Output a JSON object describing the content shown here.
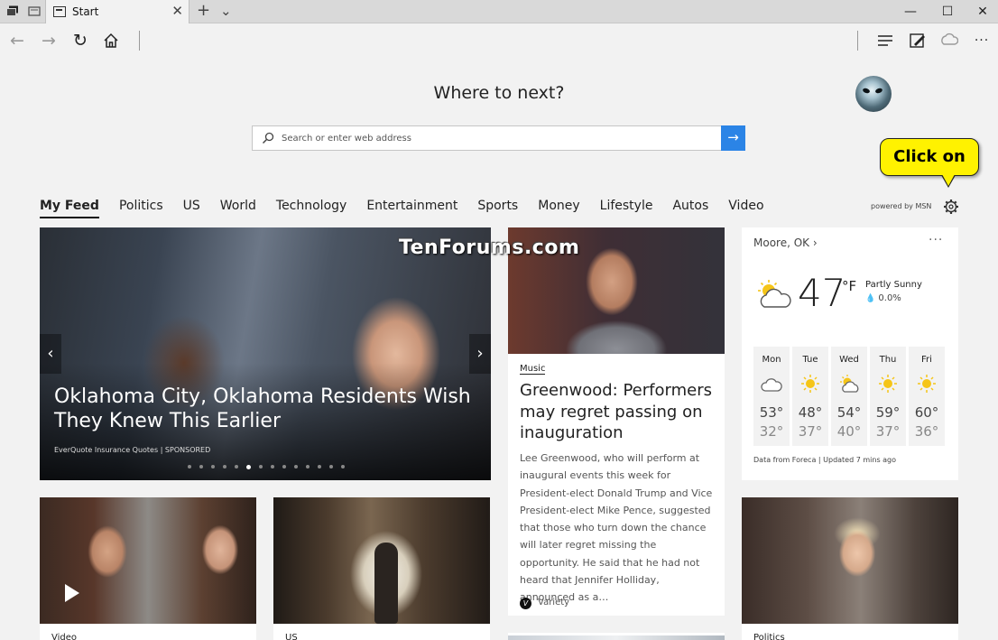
{
  "browser": {
    "tab_title": "Start",
    "new_tab_glyph": "+",
    "tab_list_glyph": "⌄",
    "close_glyph": "✕",
    "window": {
      "minimize": "—",
      "maximize": "☐",
      "close": "✕"
    },
    "nav": {
      "back": "←",
      "forward": "→",
      "refresh": "↻",
      "more": "···"
    }
  },
  "page": {
    "heading": "Where to next?",
    "search": {
      "placeholder": "Search or enter web address",
      "value": ""
    },
    "callout": "Click on",
    "powered_by": "powered by MSN",
    "watermark": "TenForums.com",
    "categories": [
      "My Feed",
      "Politics",
      "US",
      "World",
      "Technology",
      "Entertainment",
      "Sports",
      "Money",
      "Lifestyle",
      "Autos",
      "Video"
    ]
  },
  "hero": {
    "title": "Oklahoma City, Oklahoma Residents Wish They Knew This Earlier",
    "sponsor": "EverQuote Insurance Quotes | SPONSORED",
    "prev": "‹",
    "next": "›",
    "slide_count": 14,
    "active_slide": 5
  },
  "article": {
    "category": "Music",
    "title": "Greenwood: Performers may regret passing on inauguration",
    "body": "Lee Greenwood, who will perform at inaugural events this week for President-elect Donald Trump and Vice President-elect Mike Pence, suggested that those who turn down the chance will later regret missing the opportunity. He said that he had not heard that Jennifer Holliday, announced as a…",
    "source": "Variety",
    "source_icon": "V"
  },
  "weather": {
    "location": "Moore, OK ›",
    "more": "···",
    "temp": "47",
    "unit": "°F",
    "condition": "Partly Sunny",
    "precip": "0.0%",
    "forecast": [
      {
        "day": "Mon",
        "hi": "53°",
        "lo": "32°",
        "icon": "cloudy-icon"
      },
      {
        "day": "Tue",
        "hi": "48°",
        "lo": "37°",
        "icon": "sunny-icon"
      },
      {
        "day": "Wed",
        "hi": "54°",
        "lo": "40°",
        "icon": "partly-sunny-icon"
      },
      {
        "day": "Thu",
        "hi": "59°",
        "lo": "37°",
        "icon": "sunny-icon"
      },
      {
        "day": "Fri",
        "hi": "60°",
        "lo": "36°",
        "icon": "sunny-icon"
      }
    ],
    "footer": "Data from Foreca | Updated 7 mins ago"
  },
  "thumbs": [
    {
      "category": "Video"
    },
    {
      "category": "US"
    },
    {
      "category": "Politics"
    }
  ],
  "colors": {
    "accent": "#2b84e6",
    "callout": "#fff200",
    "sun": "#f5c518"
  }
}
